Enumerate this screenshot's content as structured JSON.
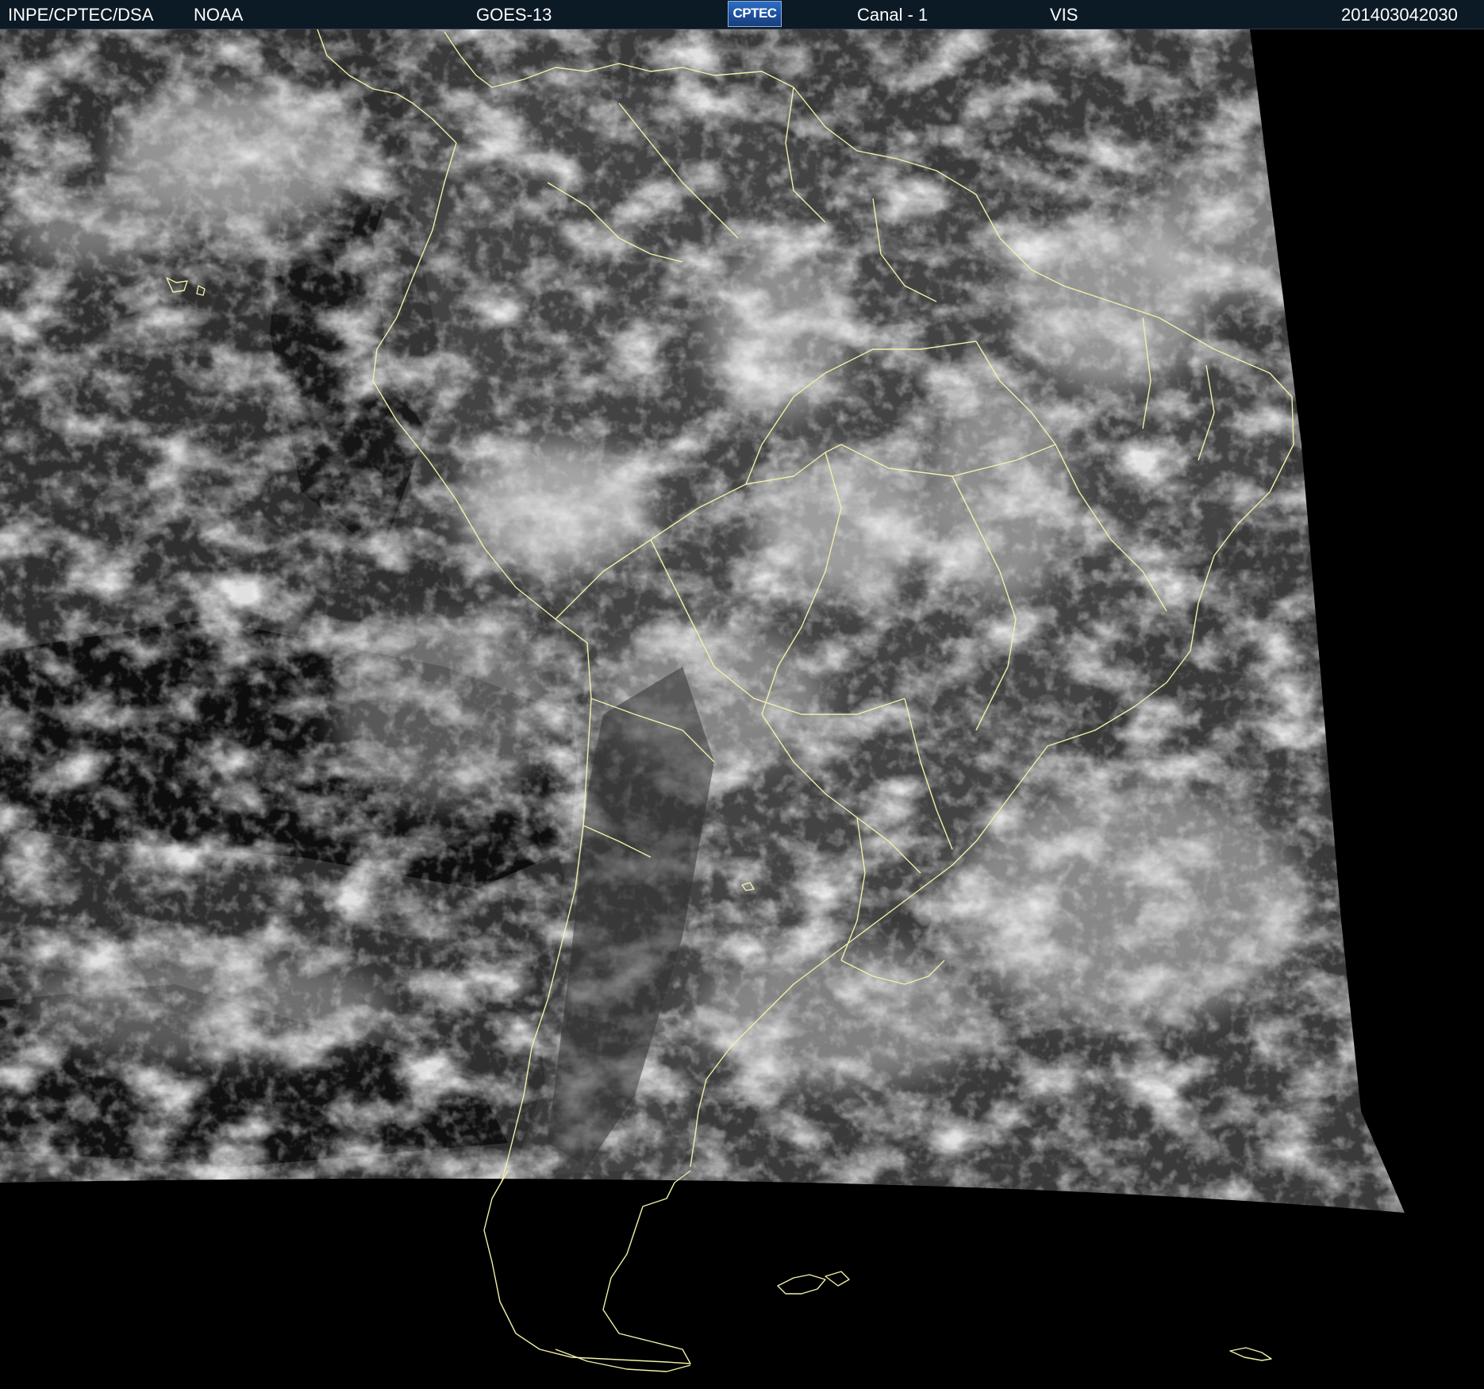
{
  "header": {
    "source_left": "INPE/CPTEC/DSA",
    "source_right": "NOAA",
    "satellite": "GOES-13",
    "logo_text": "CPTEC",
    "channel": "Canal - 1",
    "band": "VIS",
    "timestamp": "201403042030"
  },
  "colors": {
    "header_background": "#0c1a26",
    "header_text": "#ffffff",
    "coastline": "#f2f0a8",
    "space": "#000000"
  }
}
